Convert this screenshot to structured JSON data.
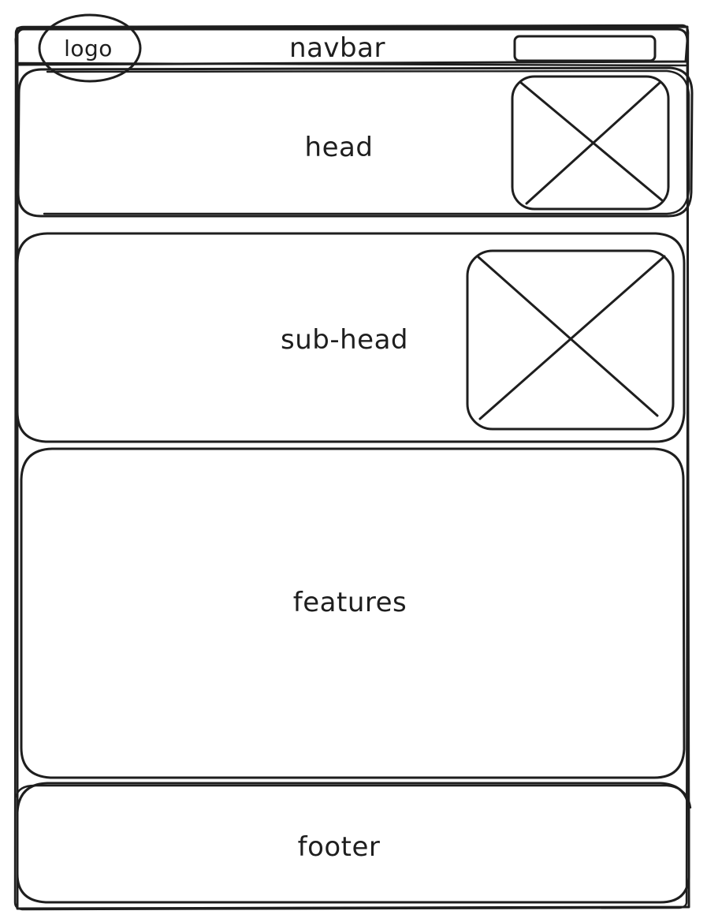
{
  "wireframe": {
    "logo_label": "logo",
    "navbar_label": "navbar",
    "head_label": "head",
    "subhead_label": "sub-head",
    "features_label": "features",
    "footer_label": "footer"
  },
  "colors": {
    "stroke": "#1e1e1e",
    "background": "#ffffff"
  }
}
